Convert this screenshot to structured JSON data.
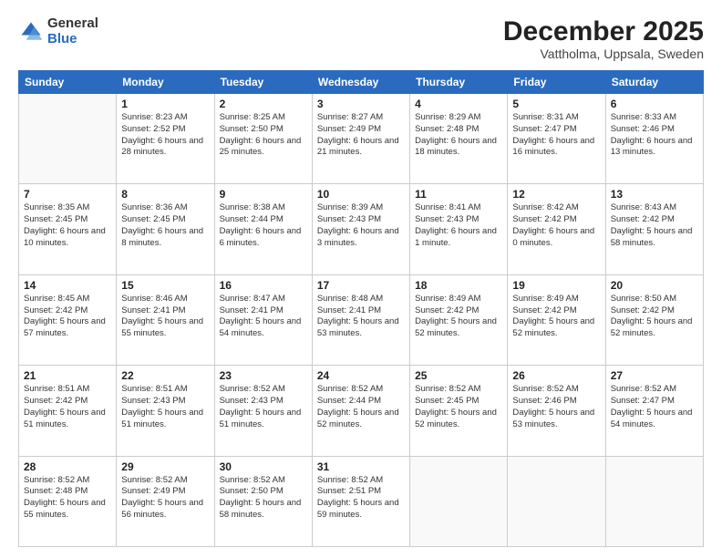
{
  "header": {
    "logo": {
      "general": "General",
      "blue": "Blue"
    },
    "title": "December 2025",
    "subtitle": "Vattholma, Uppsala, Sweden"
  },
  "calendar": {
    "days_of_week": [
      "Sunday",
      "Monday",
      "Tuesday",
      "Wednesday",
      "Thursday",
      "Friday",
      "Saturday"
    ],
    "weeks": [
      [
        {
          "day": "",
          "sunrise": "",
          "sunset": "",
          "daylight": ""
        },
        {
          "day": "1",
          "sunrise": "Sunrise: 8:23 AM",
          "sunset": "Sunset: 2:52 PM",
          "daylight": "Daylight: 6 hours and 28 minutes."
        },
        {
          "day": "2",
          "sunrise": "Sunrise: 8:25 AM",
          "sunset": "Sunset: 2:50 PM",
          "daylight": "Daylight: 6 hours and 25 minutes."
        },
        {
          "day": "3",
          "sunrise": "Sunrise: 8:27 AM",
          "sunset": "Sunset: 2:49 PM",
          "daylight": "Daylight: 6 hours and 21 minutes."
        },
        {
          "day": "4",
          "sunrise": "Sunrise: 8:29 AM",
          "sunset": "Sunset: 2:48 PM",
          "daylight": "Daylight: 6 hours and 18 minutes."
        },
        {
          "day": "5",
          "sunrise": "Sunrise: 8:31 AM",
          "sunset": "Sunset: 2:47 PM",
          "daylight": "Daylight: 6 hours and 16 minutes."
        },
        {
          "day": "6",
          "sunrise": "Sunrise: 8:33 AM",
          "sunset": "Sunset: 2:46 PM",
          "daylight": "Daylight: 6 hours and 13 minutes."
        }
      ],
      [
        {
          "day": "7",
          "sunrise": "Sunrise: 8:35 AM",
          "sunset": "Sunset: 2:45 PM",
          "daylight": "Daylight: 6 hours and 10 minutes."
        },
        {
          "day": "8",
          "sunrise": "Sunrise: 8:36 AM",
          "sunset": "Sunset: 2:45 PM",
          "daylight": "Daylight: 6 hours and 8 minutes."
        },
        {
          "day": "9",
          "sunrise": "Sunrise: 8:38 AM",
          "sunset": "Sunset: 2:44 PM",
          "daylight": "Daylight: 6 hours and 6 minutes."
        },
        {
          "day": "10",
          "sunrise": "Sunrise: 8:39 AM",
          "sunset": "Sunset: 2:43 PM",
          "daylight": "Daylight: 6 hours and 3 minutes."
        },
        {
          "day": "11",
          "sunrise": "Sunrise: 8:41 AM",
          "sunset": "Sunset: 2:43 PM",
          "daylight": "Daylight: 6 hours and 1 minute."
        },
        {
          "day": "12",
          "sunrise": "Sunrise: 8:42 AM",
          "sunset": "Sunset: 2:42 PM",
          "daylight": "Daylight: 6 hours and 0 minutes."
        },
        {
          "day": "13",
          "sunrise": "Sunrise: 8:43 AM",
          "sunset": "Sunset: 2:42 PM",
          "daylight": "Daylight: 5 hours and 58 minutes."
        }
      ],
      [
        {
          "day": "14",
          "sunrise": "Sunrise: 8:45 AM",
          "sunset": "Sunset: 2:42 PM",
          "daylight": "Daylight: 5 hours and 57 minutes."
        },
        {
          "day": "15",
          "sunrise": "Sunrise: 8:46 AM",
          "sunset": "Sunset: 2:41 PM",
          "daylight": "Daylight: 5 hours and 55 minutes."
        },
        {
          "day": "16",
          "sunrise": "Sunrise: 8:47 AM",
          "sunset": "Sunset: 2:41 PM",
          "daylight": "Daylight: 5 hours and 54 minutes."
        },
        {
          "day": "17",
          "sunrise": "Sunrise: 8:48 AM",
          "sunset": "Sunset: 2:41 PM",
          "daylight": "Daylight: 5 hours and 53 minutes."
        },
        {
          "day": "18",
          "sunrise": "Sunrise: 8:49 AM",
          "sunset": "Sunset: 2:42 PM",
          "daylight": "Daylight: 5 hours and 52 minutes."
        },
        {
          "day": "19",
          "sunrise": "Sunrise: 8:49 AM",
          "sunset": "Sunset: 2:42 PM",
          "daylight": "Daylight: 5 hours and 52 minutes."
        },
        {
          "day": "20",
          "sunrise": "Sunrise: 8:50 AM",
          "sunset": "Sunset: 2:42 PM",
          "daylight": "Daylight: 5 hours and 52 minutes."
        }
      ],
      [
        {
          "day": "21",
          "sunrise": "Sunrise: 8:51 AM",
          "sunset": "Sunset: 2:42 PM",
          "daylight": "Daylight: 5 hours and 51 minutes."
        },
        {
          "day": "22",
          "sunrise": "Sunrise: 8:51 AM",
          "sunset": "Sunset: 2:43 PM",
          "daylight": "Daylight: 5 hours and 51 minutes."
        },
        {
          "day": "23",
          "sunrise": "Sunrise: 8:52 AM",
          "sunset": "Sunset: 2:43 PM",
          "daylight": "Daylight: 5 hours and 51 minutes."
        },
        {
          "day": "24",
          "sunrise": "Sunrise: 8:52 AM",
          "sunset": "Sunset: 2:44 PM",
          "daylight": "Daylight: 5 hours and 52 minutes."
        },
        {
          "day": "25",
          "sunrise": "Sunrise: 8:52 AM",
          "sunset": "Sunset: 2:45 PM",
          "daylight": "Daylight: 5 hours and 52 minutes."
        },
        {
          "day": "26",
          "sunrise": "Sunrise: 8:52 AM",
          "sunset": "Sunset: 2:46 PM",
          "daylight": "Daylight: 5 hours and 53 minutes."
        },
        {
          "day": "27",
          "sunrise": "Sunrise: 8:52 AM",
          "sunset": "Sunset: 2:47 PM",
          "daylight": "Daylight: 5 hours and 54 minutes."
        }
      ],
      [
        {
          "day": "28",
          "sunrise": "Sunrise: 8:52 AM",
          "sunset": "Sunset: 2:48 PM",
          "daylight": "Daylight: 5 hours and 55 minutes."
        },
        {
          "day": "29",
          "sunrise": "Sunrise: 8:52 AM",
          "sunset": "Sunset: 2:49 PM",
          "daylight": "Daylight: 5 hours and 56 minutes."
        },
        {
          "day": "30",
          "sunrise": "Sunrise: 8:52 AM",
          "sunset": "Sunset: 2:50 PM",
          "daylight": "Daylight: 5 hours and 58 minutes."
        },
        {
          "day": "31",
          "sunrise": "Sunrise: 8:52 AM",
          "sunset": "Sunset: 2:51 PM",
          "daylight": "Daylight: 5 hours and 59 minutes."
        },
        {
          "day": "",
          "sunrise": "",
          "sunset": "",
          "daylight": ""
        },
        {
          "day": "",
          "sunrise": "",
          "sunset": "",
          "daylight": ""
        },
        {
          "day": "",
          "sunrise": "",
          "sunset": "",
          "daylight": ""
        }
      ]
    ]
  }
}
